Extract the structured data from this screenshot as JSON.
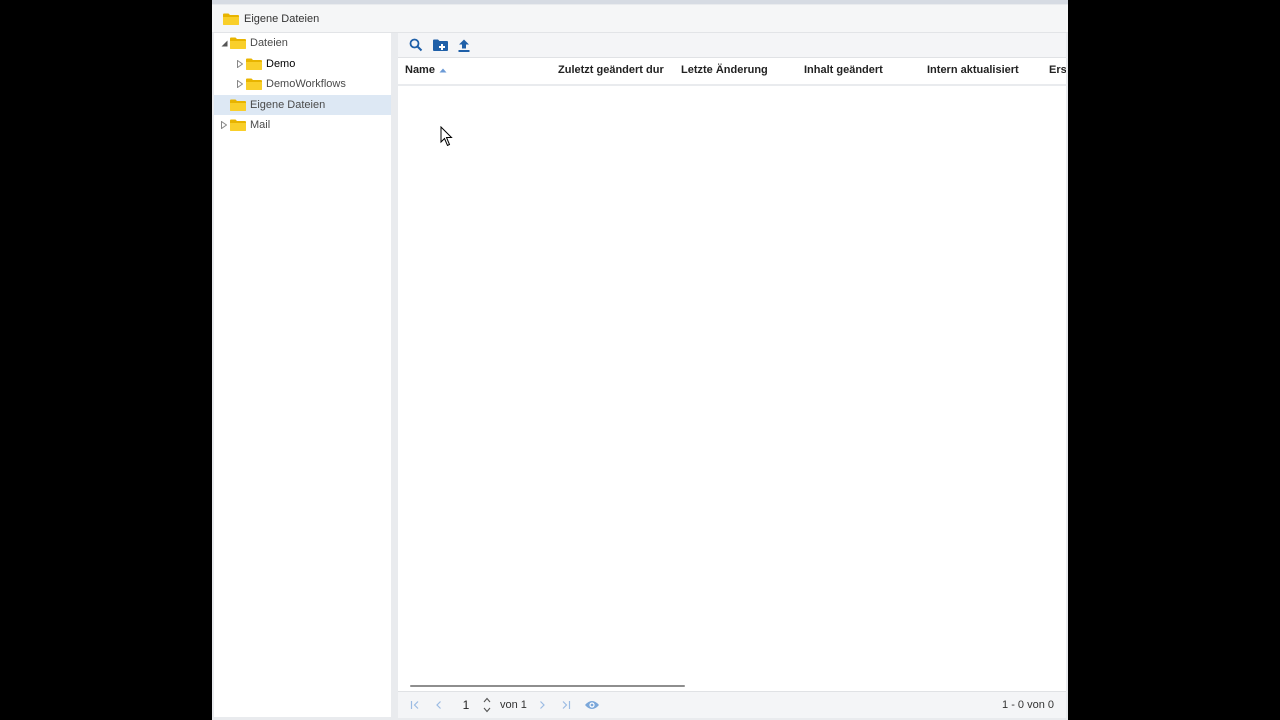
{
  "window": {
    "title": "Eigene Dateien"
  },
  "tree": {
    "items": [
      {
        "label": "Dateien",
        "expanded": true
      },
      {
        "label": "Demo"
      },
      {
        "label": "DemoWorkflows"
      },
      {
        "label": "Eigene Dateien",
        "selected": true
      },
      {
        "label": "Mail"
      }
    ]
  },
  "toolbar": {
    "icons": [
      "search-icon",
      "new-folder-icon",
      "upload-icon"
    ]
  },
  "grid": {
    "columns": [
      "Name",
      "Zuletzt geändert dur",
      "Letzte Änderung",
      "Inhalt geändert",
      "Intern aktualisiert",
      "Ers"
    ],
    "sort": {
      "column": "Name",
      "direction": "ascending"
    },
    "rows": []
  },
  "pager": {
    "page": "1",
    "of_label": "von 1",
    "count_label": "1 - 0 von 0"
  },
  "colors": {
    "accent": "#1e5fa8",
    "folder": "#f5c518",
    "selected": "#dde8f4"
  }
}
